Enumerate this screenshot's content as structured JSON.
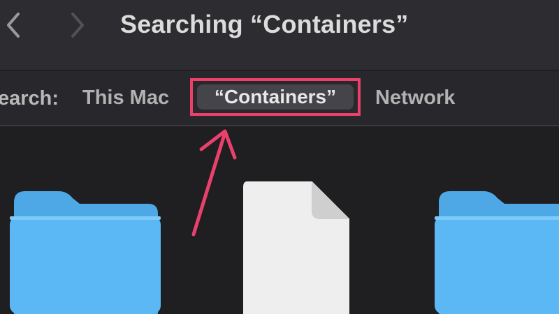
{
  "window": {
    "title": "Searching “Containers”"
  },
  "toolbar": {
    "back_icon": "chevron-left-icon",
    "forward_icon": "chevron-right-icon"
  },
  "scope_bar": {
    "label": "earch:",
    "items": [
      {
        "label": "This Mac",
        "selected": false
      },
      {
        "label": "“Containers”",
        "selected": true
      },
      {
        "label": "Network",
        "selected": false
      }
    ]
  },
  "annotation": {
    "highlight_color": "#e9416c",
    "arrow_icon": "arrow-up-icon"
  },
  "files": [
    {
      "kind": "folder",
      "icon": "folder-icon",
      "color": "#57b6f2"
    },
    {
      "kind": "document",
      "icon": "document-icon",
      "color": "#f2f2f2"
    },
    {
      "kind": "folder",
      "icon": "folder-icon",
      "color": "#57b6f2"
    }
  ]
}
